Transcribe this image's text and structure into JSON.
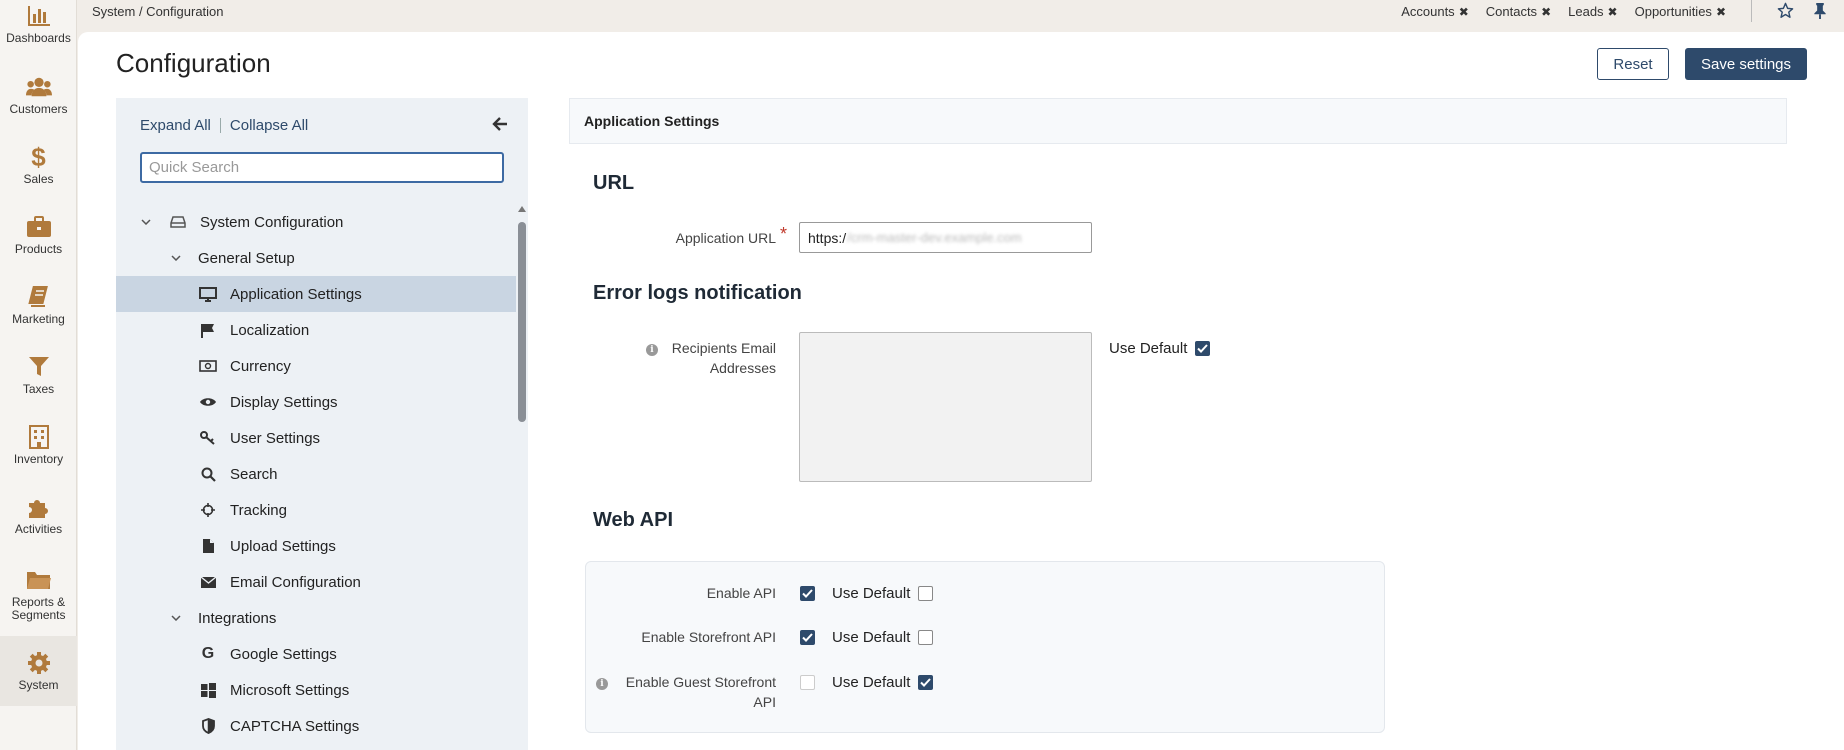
{
  "nav": [
    {
      "label": "Dashboards",
      "icon": "bar-chart-icon"
    },
    {
      "label": "Customers",
      "icon": "users-icon"
    },
    {
      "label": "Sales",
      "icon": "dollar-icon"
    },
    {
      "label": "Products",
      "icon": "briefcase-icon"
    },
    {
      "label": "Marketing",
      "icon": "book-icon"
    },
    {
      "label": "Taxes",
      "icon": "filter-icon"
    },
    {
      "label": "Inventory",
      "icon": "building-icon"
    },
    {
      "label": "Activities",
      "icon": "puzzle-icon"
    },
    {
      "label": "Reports & Segments",
      "icon": "folder-icon"
    },
    {
      "label": "System",
      "icon": "gear-icon"
    }
  ],
  "breadcrumb": "System / Configuration",
  "pinned": [
    "Accounts",
    "Contacts",
    "Leads",
    "Opportunities"
  ],
  "page_title": "Configuration",
  "buttons": {
    "reset": "Reset",
    "save": "Save settings"
  },
  "tree": {
    "expand_all": "Expand All",
    "collapse_all": "Collapse All",
    "search_placeholder": "Quick Search",
    "items": [
      {
        "label": "System Configuration",
        "icon": "drive-icon"
      },
      {
        "label": "General Setup"
      },
      {
        "label": "Application Settings",
        "icon": "monitor-icon"
      },
      {
        "label": "Localization",
        "icon": "flag-icon"
      },
      {
        "label": "Currency",
        "icon": "money-icon"
      },
      {
        "label": "Display Settings",
        "icon": "eye-icon"
      },
      {
        "label": "User Settings",
        "icon": "key-icon"
      },
      {
        "label": "Search",
        "icon": "search-icon"
      },
      {
        "label": "Tracking",
        "icon": "crosshair-icon"
      },
      {
        "label": "Upload Settings",
        "icon": "file-icon"
      },
      {
        "label": "Email Configuration",
        "icon": "envelope-icon"
      },
      {
        "label": "Integrations"
      },
      {
        "label": "Google Settings",
        "icon": "google-icon"
      },
      {
        "label": "Microsoft Settings",
        "icon": "windows-icon"
      },
      {
        "label": "CAPTCHA Settings",
        "icon": "shield-icon"
      }
    ]
  },
  "content": {
    "section_title": "Application Settings",
    "url_heading": "URL",
    "app_url_label": "Application URL",
    "app_url_prefix": "https:/",
    "app_url_blurred": "/crm-master-dev.example.com",
    "error_heading": "Error logs notification",
    "recipients_label_1": "Recipients Email",
    "recipients_label_2": "Addresses",
    "use_default": "Use Default",
    "web_api_heading": "Web API",
    "enable_api": "Enable API",
    "enable_storefront_api": "Enable Storefront API",
    "enable_guest_1": "Enable Guest Storefront",
    "enable_guest_2": "API"
  },
  "colors": {
    "accent": "#2e4a6b",
    "nav_icon": "#b07a3c",
    "active_row": "#c9d5e2",
    "required": "#c0392b"
  }
}
